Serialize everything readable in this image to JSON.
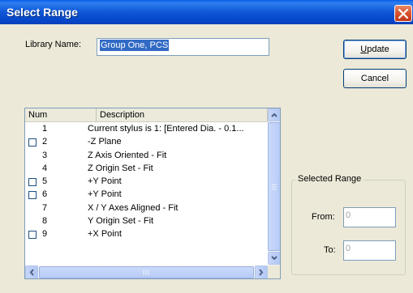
{
  "dialog": {
    "title": "Select Range",
    "library_label": "Library Name:",
    "library_value": "Group One, PCS",
    "update_label": "Update",
    "update_accel": "U",
    "update_rest": "pdate",
    "cancel_label": "Cancel"
  },
  "list": {
    "columns": [
      "Num",
      "Description"
    ],
    "rows": [
      {
        "checkbox": false,
        "num": "1",
        "desc": "Current stylus is 1: [Entered Dia. - 0.1..."
      },
      {
        "checkbox": true,
        "num": "2",
        "desc": "-Z Plane"
      },
      {
        "checkbox": false,
        "num": "3",
        "desc": "Z Axis Oriented - Fit"
      },
      {
        "checkbox": false,
        "num": "4",
        "desc": "Z Origin Set - Fit"
      },
      {
        "checkbox": true,
        "num": "5",
        "desc": "+Y Point"
      },
      {
        "checkbox": true,
        "num": "6",
        "desc": "+Y Point"
      },
      {
        "checkbox": false,
        "num": "7",
        "desc": "X / Y Axes Aligned - Fit"
      },
      {
        "checkbox": false,
        "num": "8",
        "desc": "Y Origin Set - Fit"
      },
      {
        "checkbox": true,
        "num": "9",
        "desc": "+X Point"
      }
    ]
  },
  "range": {
    "group_label": "Selected Range",
    "from_label": "From:",
    "from_value": "0",
    "to_label": "To:",
    "to_value": "0"
  },
  "colors": {
    "titlebar": "#0A54E0",
    "dialog_bg": "#ECE9D8",
    "selection": "#316AC5",
    "close": "#D9502C"
  }
}
